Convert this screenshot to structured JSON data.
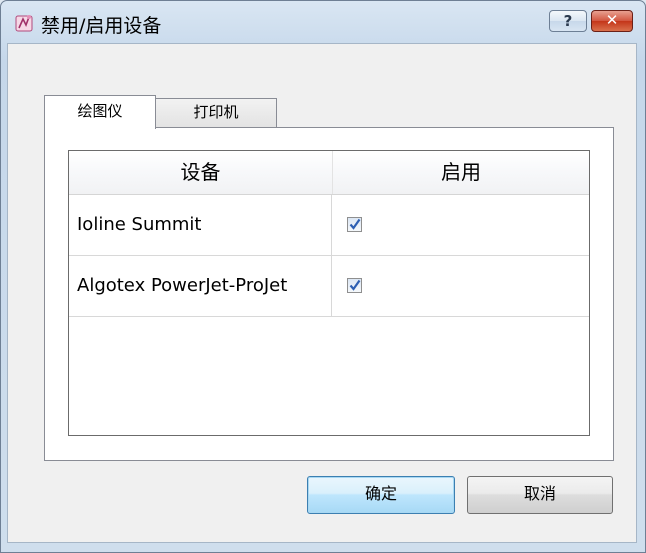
{
  "window": {
    "title": "禁用/启用设备",
    "help_label": "?",
    "close_label": "✕"
  },
  "tabs": [
    {
      "label": "绘图仪",
      "active": true
    },
    {
      "label": "打印机",
      "active": false
    }
  ],
  "table": {
    "columns": [
      "设备",
      "启用"
    ],
    "rows": [
      {
        "device": "Ioline Summit",
        "enabled": true
      },
      {
        "device": "Algotex PowerJet-ProJet",
        "enabled": true
      }
    ]
  },
  "buttons": {
    "ok_label": "确定",
    "cancel_label": "取消"
  },
  "colors": {
    "accent": "#3c7fb1",
    "close": "#c43519",
    "check": "#2d5fb3"
  }
}
